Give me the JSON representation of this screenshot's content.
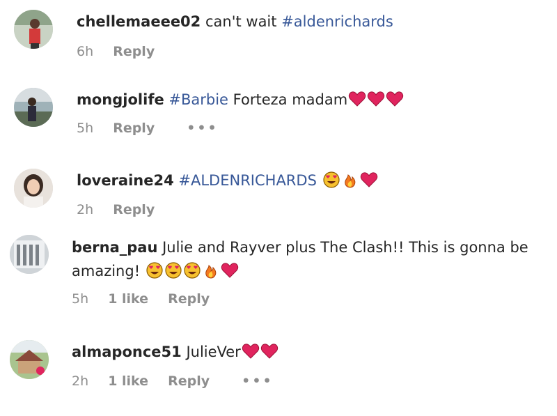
{
  "comments": [
    {
      "username": "chellemaeee02",
      "text": "can't wait",
      "hashtag": "#aldenrichards",
      "time": "6h",
      "reply_label": "Reply"
    },
    {
      "username": "mongjolife",
      "hashtag": "#Barbie",
      "text": "Forteza madam",
      "emojis": [
        "red-heart",
        "red-heart",
        "red-heart"
      ],
      "time": "5h",
      "reply_label": "Reply",
      "more_label": "•••"
    },
    {
      "username": "loveraine24",
      "hashtag": "#ALDENRICHARDS",
      "emojis": [
        "heart-eyes-face",
        "fire",
        "red-heart"
      ],
      "time": "2h",
      "reply_label": "Reply"
    },
    {
      "username": "berna_pau",
      "text_line1": "Julie and Rayver plus The Clash!! This is gonna be",
      "text_line2": "amazing!",
      "emojis": [
        "heart-eyes-face",
        "heart-eyes-face",
        "heart-eyes-face",
        "fire",
        "red-heart"
      ],
      "time": "5h",
      "likes": "1 like",
      "reply_label": "Reply"
    },
    {
      "username": "almaponce51",
      "text": "JulieVer",
      "emojis": [
        "red-heart",
        "red-heart"
      ],
      "time": "2h",
      "likes": "1 like",
      "reply_label": "Reply",
      "more_label": "•••"
    }
  ],
  "colors": {
    "username": "#262626",
    "hashtag": "#385898",
    "meta": "#8e8e8e",
    "heart": "#e0245e"
  }
}
